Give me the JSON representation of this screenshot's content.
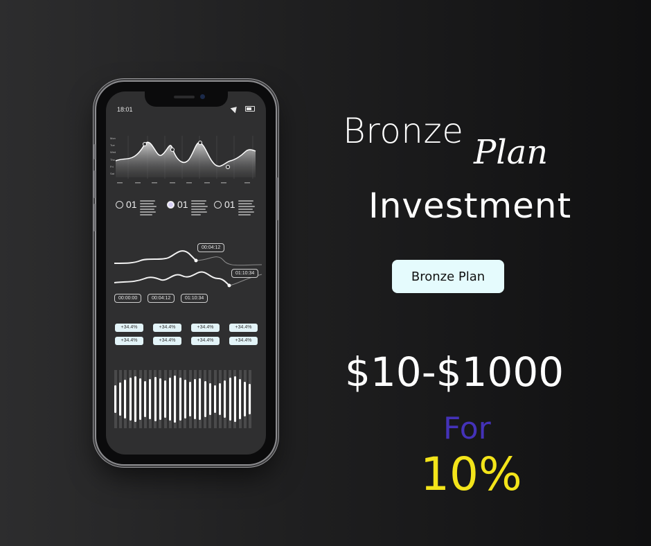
{
  "headline": {
    "word1": "Bronze",
    "word2": "Plan",
    "word3": "Investment"
  },
  "plan_button": {
    "label": "Bronze Plan"
  },
  "price": {
    "range": "$10-$1000"
  },
  "rate": {
    "for_label": "For",
    "percent": "10%"
  },
  "colors": {
    "accent_for": "#4432b8",
    "accent_percent": "#f3e41a",
    "button_bg": "#e5fbfd"
  },
  "phone": {
    "status_time": "18:01",
    "chart_day_labels": [
      "Mon",
      "Tue",
      "Wed",
      "Thu",
      "Fri",
      "Sat"
    ],
    "list_items": [
      {
        "number": "01",
        "selected": false
      },
      {
        "number": "01",
        "selected": true
      },
      {
        "number": "01",
        "selected": false
      }
    ],
    "timeline_tags": {
      "upper": "00:04:12",
      "lower": "01:10:34"
    },
    "time_buttons": [
      "00:00:00",
      "00:04:12",
      "01:10:34"
    ],
    "pct_badges": [
      "+34.4%",
      "+34.4%",
      "+34.4%",
      "+34.4%",
      "+34.4%",
      "+34.4%",
      "+34.4%",
      "+34.4%"
    ]
  }
}
